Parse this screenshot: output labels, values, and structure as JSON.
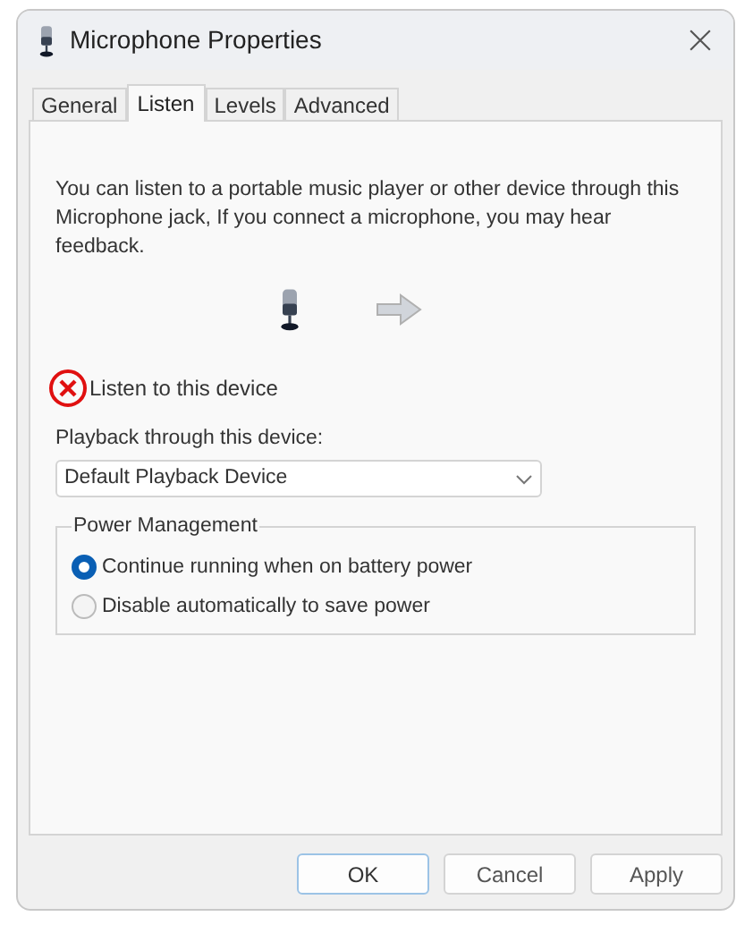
{
  "window": {
    "title": "Microphone Properties"
  },
  "tabs": [
    {
      "label": "General",
      "selected": false
    },
    {
      "label": "Listen",
      "selected": true
    },
    {
      "label": "Levels",
      "selected": false
    },
    {
      "label": "Advanced",
      "selected": false
    }
  ],
  "description": "You can listen to a portable music player or other device through this Microphone jack, If you connect a microphone, you may hear feedback.",
  "listen_checkbox": {
    "label": "Listen to this device"
  },
  "playback": {
    "label": "Playback through this device:",
    "value": "Default Playback Device"
  },
  "power_management": {
    "title": "Power Management",
    "options": [
      {
        "label": "Continue running when on battery power",
        "selected": true
      },
      {
        "label": "Disable automatically to save power",
        "selected": false
      }
    ]
  },
  "buttons": [
    {
      "label": "OK",
      "kind": "default"
    },
    {
      "label": "Cancel",
      "kind": "normal"
    },
    {
      "label": "Apply",
      "kind": "normal"
    }
  ]
}
